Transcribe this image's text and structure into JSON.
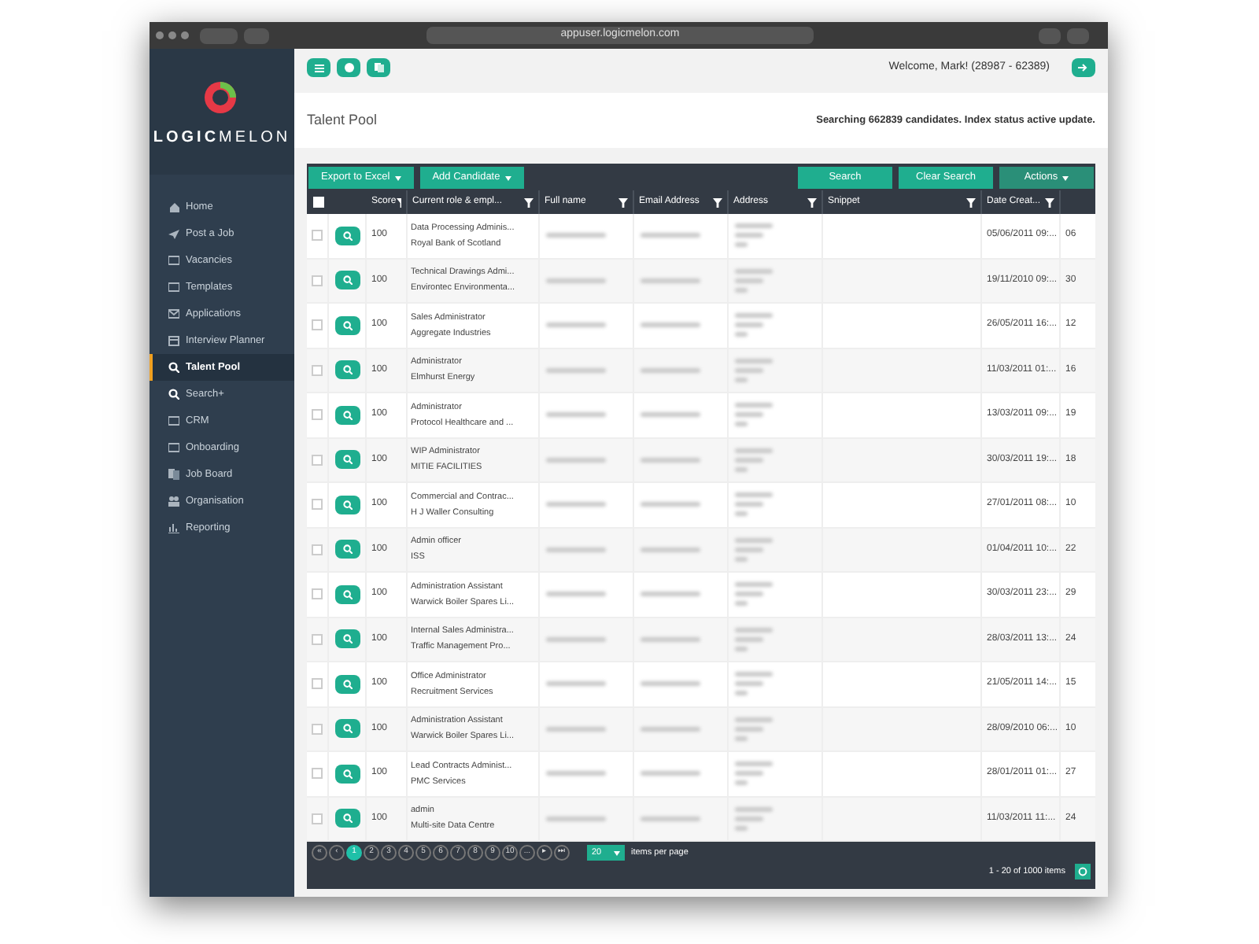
{
  "browser": {
    "url": "appuser.logicmelon.com"
  },
  "logo": {
    "text_bold": "LOGIC",
    "text_light": "MELON"
  },
  "sidebar": {
    "items": [
      {
        "label": "Home",
        "kind": "home",
        "selected": false
      },
      {
        "label": "Post a Job",
        "kind": "plane",
        "selected": false
      },
      {
        "label": "Vacancies",
        "kind": "list",
        "selected": false
      },
      {
        "label": "Templates",
        "kind": "list",
        "selected": false
      },
      {
        "label": "Applications",
        "kind": "mail",
        "selected": false
      },
      {
        "label": "Interview Planner",
        "kind": "calendar",
        "selected": false
      },
      {
        "label": "Talent Pool",
        "kind": "search",
        "selected": true
      },
      {
        "label": "Search+",
        "kind": "search",
        "selected": false
      },
      {
        "label": "CRM",
        "kind": "list",
        "selected": false
      },
      {
        "label": "Onboarding",
        "kind": "list",
        "selected": false
      },
      {
        "label": "Job Board",
        "kind": "board",
        "selected": false
      },
      {
        "label": "Organisation",
        "kind": "people",
        "selected": false
      },
      {
        "label": "Reporting",
        "kind": "chart",
        "selected": false
      }
    ]
  },
  "header": {
    "welcome": "Welcome, Mark! (28987 - 62389)"
  },
  "page": {
    "title": "Talent Pool",
    "status": "Searching 662839 candidates. Index status active update."
  },
  "toolbar": {
    "left": [
      "Export to Excel",
      "Add Candidate"
    ],
    "right": [
      {
        "label": "Search",
        "kind": "plain"
      },
      {
        "label": "Clear Search",
        "kind": "plain"
      },
      {
        "label": "Actions",
        "kind": "menu"
      }
    ]
  },
  "table": {
    "select_all_checked": false,
    "columns": [
      "Score",
      "Current role & empl...",
      "Full name",
      "Email Address",
      "Address",
      "Snippet",
      "Date Creat..."
    ],
    "rows": [
      {
        "score": "100",
        "role": "Data Processing Adminis...",
        "employer": "Royal Bank of Scotland",
        "date": "05/06/2011 09:...",
        "column_9": "06",
        "checked": false
      },
      {
        "score": "100",
        "role": "Technical Drawings Admi...",
        "employer": "Environtec Environmenta...",
        "date": "19/11/2010 09:...",
        "column_9": "30",
        "checked": false
      },
      {
        "score": "100",
        "role": "Sales Administrator",
        "employer": "Aggregate Industries",
        "date": "26/05/2011 16:...",
        "column_9": "12",
        "checked": false
      },
      {
        "score": "100",
        "role": "Administrator",
        "employer": "Elmhurst Energy",
        "date": "11/03/2011 01:...",
        "column_9": "16",
        "checked": false
      },
      {
        "score": "100",
        "role": "Administrator",
        "employer": "Protocol Healthcare and ...",
        "date": "13/03/2011 09:...",
        "column_9": "19",
        "checked": false
      },
      {
        "score": "100",
        "role": "WIP Administrator",
        "employer": "MITIE FACILITIES",
        "date": "30/03/2011 19:...",
        "column_9": "18",
        "checked": false
      },
      {
        "score": "100",
        "role": "Commercial and Contrac...",
        "employer": "H J Waller Consulting",
        "date": "27/01/2011 08:...",
        "column_9": "10",
        "checked": false
      },
      {
        "score": "100",
        "role": "Admin officer",
        "employer": "ISS",
        "date": "01/04/2011 10:...",
        "column_9": "22",
        "checked": false
      },
      {
        "score": "100",
        "role": "Administration Assistant",
        "employer": "Warwick Boiler Spares Li...",
        "date": "30/03/2011 23:...",
        "column_9": "29",
        "checked": false
      },
      {
        "score": "100",
        "role": "Internal Sales Administra...",
        "employer": "Traffic Management Pro...",
        "date": "28/03/2011 13:...",
        "column_9": "24",
        "checked": false
      },
      {
        "score": "100",
        "role": "Office Administrator",
        "employer": "Recruitment Services",
        "date": "21/05/2011 14:...",
        "column_9": "15",
        "checked": false
      },
      {
        "score": "100",
        "role": "Administration Assistant",
        "employer": "Warwick Boiler Spares Li...",
        "date": "28/09/2010 06:...",
        "column_9": "10",
        "checked": false
      },
      {
        "score": "100",
        "role": "Lead Contracts Administ...",
        "employer": "PMC Services",
        "date": "28/01/2011 01:...",
        "column_9": "27",
        "checked": false
      },
      {
        "score": "100",
        "role": "admin",
        "employer": "Multi-site Data Centre",
        "date": "11/03/2011 11:...",
        "column_9": "24",
        "checked": false
      }
    ]
  },
  "pagination": {
    "first": "«",
    "prev": "‹",
    "pages": [
      {
        "label": "1",
        "selected": true
      },
      {
        "label": "2",
        "selected": false
      },
      {
        "label": "3",
        "selected": false
      },
      {
        "label": "4",
        "selected": false
      },
      {
        "label": "5",
        "selected": false
      },
      {
        "label": "6",
        "selected": false
      },
      {
        "label": "7",
        "selected": false
      },
      {
        "label": "8",
        "selected": false
      },
      {
        "label": "9",
        "selected": false
      },
      {
        "label": "10",
        "selected": false
      },
      {
        "label": "...",
        "selected": false
      }
    ],
    "next": "▸",
    "last": "⏭",
    "page_size": "20",
    "page_size_label": "items per page",
    "summary": "1 - 20 of 1000 items"
  }
}
